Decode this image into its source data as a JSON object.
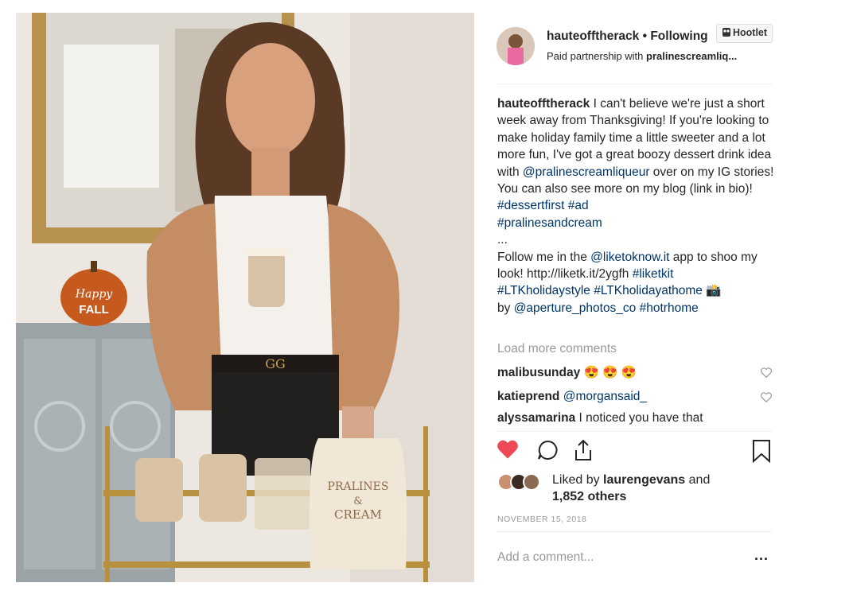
{
  "post": {
    "username": "hauteofftherack",
    "follow_separator": " • ",
    "follow_label": "Following",
    "partnership_prefix": "Paid partnership with ",
    "partnership_account": "pralinescreamliq...",
    "hootlet_label": "Hootlet"
  },
  "caption": {
    "author": "hauteofftherack",
    "text_1": " I can't believe we're just a short week away from Thanksgiving! If you're looking to make holiday family time a little sweeter and a lot more fun, I've got a great boozy dessert drink idea with ",
    "mention_1": "@pralinescreamliqueur",
    "text_2": " over on my IG stories! You can also see more on my blog (link in bio)! ",
    "hashtag_1": "#dessertfirst",
    "hashtag_2": "#ad",
    "hashtag_3": "#pralinesandcream",
    "ellipsis": "...",
    "text_3": "Follow me in the ",
    "mention_2": "@liketoknow.it",
    "text_4": " app to shoo my look! http://liketk.it/2ygfh ",
    "hashtag_4": "#liketkit",
    "hashtag_5": "#LTKholidaystyle",
    "hashtag_6": "#LTKholidayathome",
    "camera_emoji": "📸",
    "text_5": "by ",
    "mention_3": "@aperture_photos_co",
    "hashtag_7": "#hotrhome"
  },
  "comments": {
    "load_more": "Load more comments",
    "items": [
      {
        "user": "malibusunday",
        "text": " 😍 😍 😍"
      },
      {
        "user": "katieprend",
        "text": "@morgansaid_"
      },
      {
        "user": "alyssamarina",
        "text": " I noticed you have that"
      }
    ]
  },
  "likes": {
    "prefix": "Liked by ",
    "user": "laurengevans",
    "middle": " and",
    "count": "1,852 others"
  },
  "date": "NOVEMBER 15, 2018",
  "add_comment_placeholder": "Add a comment...",
  "more_label": "...",
  "photo": {
    "pumpkin_line_1": "Happy",
    "pumpkin_line_2": "FALL",
    "bottle_line_1": "PRALINES",
    "bottle_line_2": "&",
    "bottle_line_3": "CREAM"
  },
  "colors": {
    "liked_heart": "#ed4956",
    "link": "#003569",
    "muted": "#999999"
  },
  "icons": {
    "like": "heart-icon",
    "comment": "speech-bubble-icon",
    "share": "share-icon",
    "save": "bookmark-icon"
  }
}
